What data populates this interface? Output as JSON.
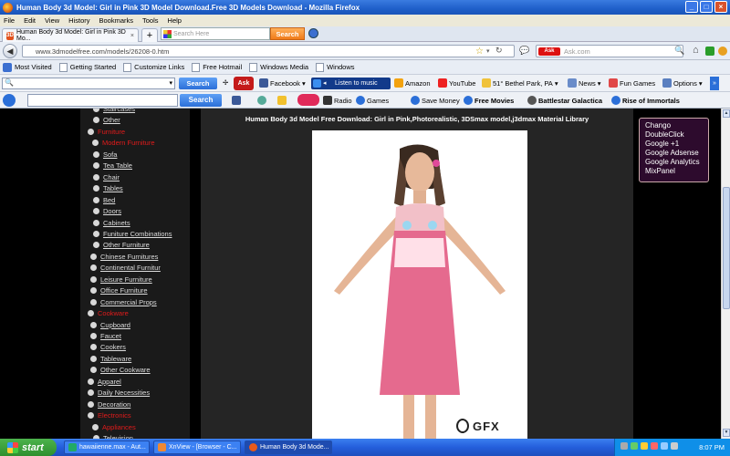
{
  "window": {
    "title": "Human Body 3d Model: Girl in Pink 3D Model Download.Free 3D Models Download - Mozilla Firefox",
    "controls": [
      "_",
      "□",
      "×"
    ]
  },
  "menu": [
    "File",
    "Edit",
    "View",
    "History",
    "Bookmarks",
    "Tools",
    "Help"
  ],
  "tab": {
    "label": "Human Body 3d Model: Girl in Pink 3D Mo...",
    "close": "×",
    "new": "+"
  },
  "tab_search": {
    "placeholder": "Search Here",
    "button": "Search"
  },
  "address": {
    "url": "www.3dmodelfree.com/models/26208-0.htm",
    "ask_placeholder": "Ask.com"
  },
  "bookmarks": [
    "Most Visited",
    "Getting Started",
    "Customize Links",
    "Free Hotmail",
    "Windows Media",
    "Windows"
  ],
  "toolbar1": {
    "search_button": "Search",
    "facebook": "Facebook",
    "listen": "Listen to music",
    "amazon": "Amazon",
    "youtube": "YouTube",
    "weather": "51° Bethel Park, PA",
    "news": "News",
    "fun_games": "Fun Games",
    "options": "Options"
  },
  "toolbar2": {
    "search_button": "Search",
    "radio": "Radio",
    "games": "Games",
    "save_money": "Save Money",
    "free_movies": "Free Movies",
    "battlestar": "Battlestar Galactica",
    "rise": "Rise of Immortals"
  },
  "page": {
    "title": "Human Body 3d Model Free Download: Girl in Pink,Photorealistic, 3DSmax model,j3dmax Material Library",
    "watermark": "GFX"
  },
  "sidebar": [
    {
      "label": "Staircases",
      "type": "item"
    },
    {
      "label": "Other",
      "type": "item"
    },
    {
      "label": "Furniture",
      "type": "cat"
    },
    {
      "label": "Modern Furniture",
      "type": "subcat"
    },
    {
      "label": "Sofa",
      "type": "sub"
    },
    {
      "label": "Tea Table",
      "type": "sub"
    },
    {
      "label": "Chair",
      "type": "sub"
    },
    {
      "label": "Tables",
      "type": "sub"
    },
    {
      "label": "Bed",
      "type": "sub"
    },
    {
      "label": "Doors",
      "type": "sub"
    },
    {
      "label": "Cabinets",
      "type": "sub"
    },
    {
      "label": "Funiture Combinations",
      "type": "sub"
    },
    {
      "label": "Other Furniture",
      "type": "sub"
    },
    {
      "label": "Chinese Furnitures",
      "type": "item"
    },
    {
      "label": "Continental Furnitur",
      "type": "item"
    },
    {
      "label": "Leisure Furniture",
      "type": "item"
    },
    {
      "label": "Office Furniture",
      "type": "item"
    },
    {
      "label": "Commercial Props",
      "type": "item"
    },
    {
      "label": "Cookware",
      "type": "cat"
    },
    {
      "label": "Cupboard",
      "type": "item"
    },
    {
      "label": "Faucet",
      "type": "item"
    },
    {
      "label": "Cookers",
      "type": "item"
    },
    {
      "label": "Tableware",
      "type": "item"
    },
    {
      "label": "Other Cookware",
      "type": "item"
    },
    {
      "label": "Apparel",
      "type": "cat-white"
    },
    {
      "label": "Daily Necessities",
      "type": "cat-white"
    },
    {
      "label": "Decoration",
      "type": "cat-white"
    },
    {
      "label": "Electronics",
      "type": "cat"
    },
    {
      "label": "Appliances",
      "type": "subcat"
    },
    {
      "label": "Television",
      "type": "sub"
    }
  ],
  "tooltip": [
    "Chango",
    "DoubleClick",
    "Google +1",
    "Google Adsense",
    "Google Analytics",
    "MixPanel"
  ],
  "taskbar": {
    "start": "start",
    "tasks": [
      "hawaiienne.max - Aut...",
      "XnView - [Browser - C...",
      "Human Body 3d Mode..."
    ],
    "clock": "8:07 PM"
  }
}
